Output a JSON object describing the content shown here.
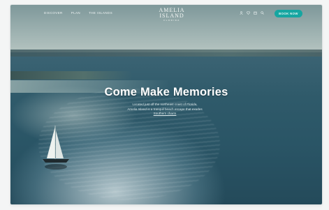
{
  "nav": {
    "links": [
      "Discover",
      "Plan",
      "The Islands"
    ],
    "logo_title": "AMELIA ISLAND",
    "logo_sub": "FLORIDA",
    "book_label": "BOOK NOW"
  },
  "hero": {
    "headline": "Come Make Memories",
    "lede_line1": "Located just off the northeast coast of Florida,",
    "lede_line2": "Amelia Island is a tranquil beach escape that exudes",
    "lede_link": "Southern charm"
  },
  "icons": [
    "user-icon",
    "heart-icon",
    "calendar-icon",
    "search-icon"
  ],
  "colors": {
    "accent": "#16a6a1",
    "sea": "#2a5566",
    "sky": "#9eb2b1"
  }
}
